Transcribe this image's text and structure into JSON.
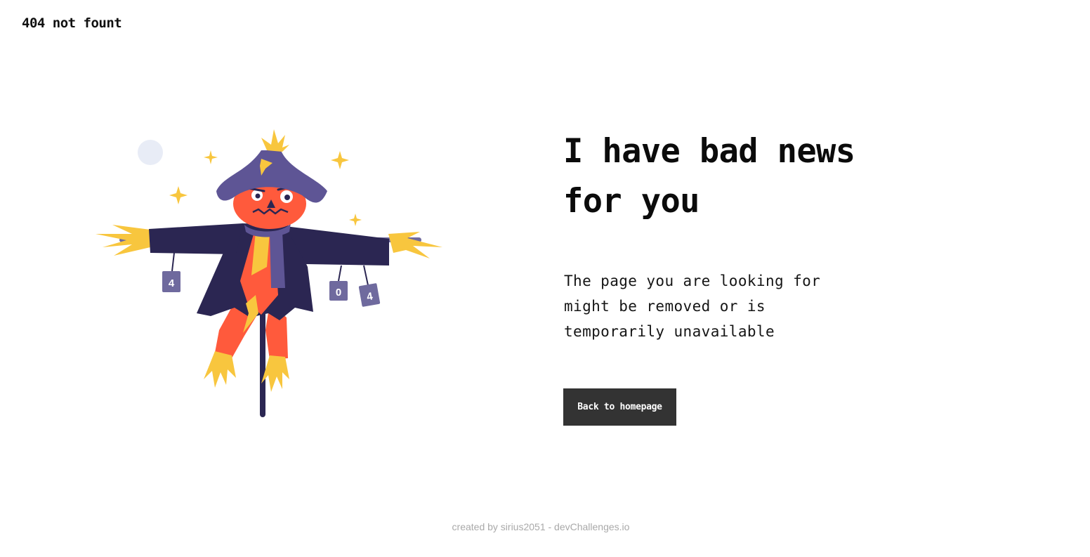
{
  "brand": {
    "label": "404 not fount"
  },
  "illustration": {
    "tags": [
      "4",
      "0",
      "4"
    ],
    "colors": {
      "hat": "#5E5595",
      "coat": "#2B2652",
      "face": "#FF5A3C",
      "straw": "#F8C63E",
      "pole": "#2B2652",
      "moon": "#E8ECF6"
    }
  },
  "content": {
    "headline": "I have bad news for you",
    "message": "The page you are looking for might be removed or is temporarily unavailable",
    "button_label": "Back to homepage"
  },
  "footer": {
    "credit": "created by sirius2051 - devChallenges.io"
  },
  "colors": {
    "button_bg": "#333333",
    "button_text": "#ffffff",
    "text": "#111111",
    "footer_text": "#a9a9a9"
  }
}
